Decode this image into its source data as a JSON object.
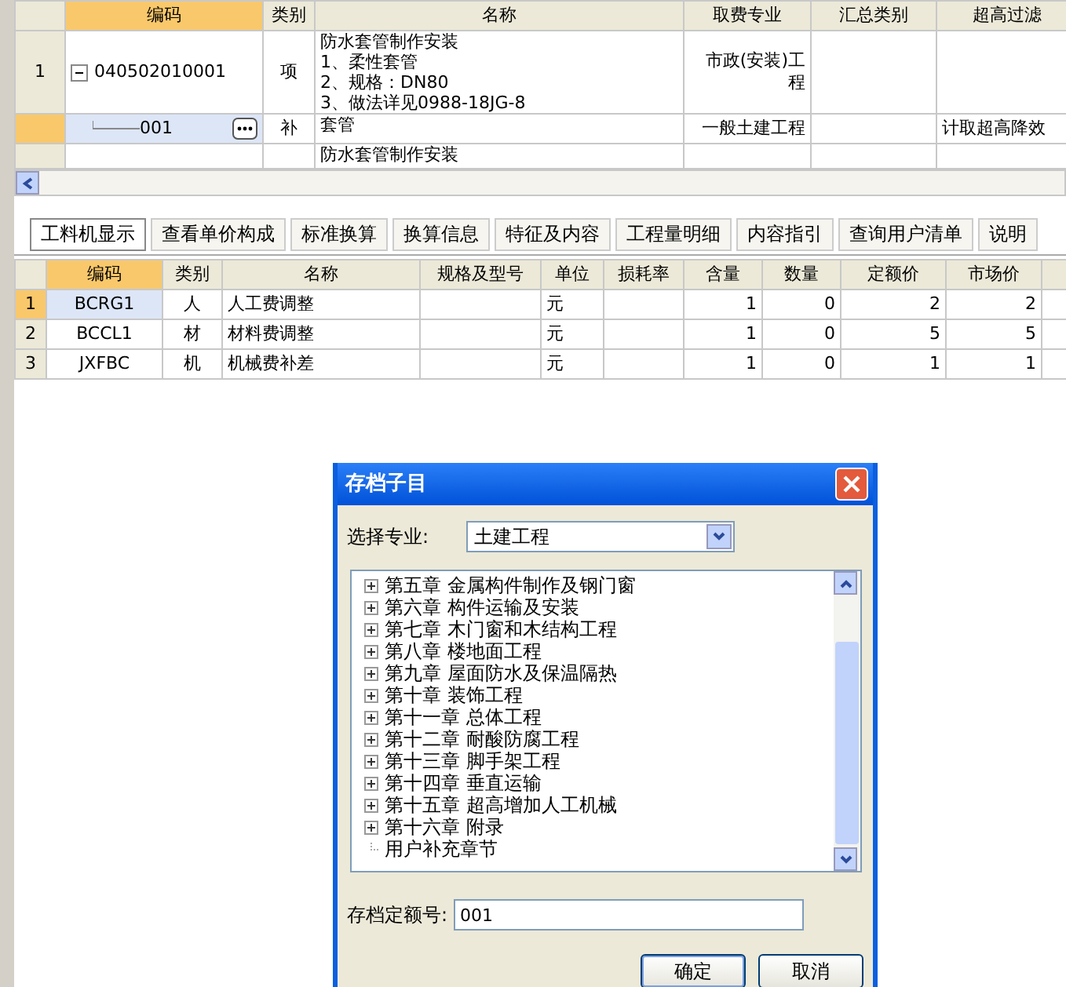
{
  "top_grid": {
    "columns": [
      "编码",
      "类别",
      "名称",
      "取费专业",
      "汇总类别",
      "超高过滤"
    ],
    "rows": [
      {
        "row_header": "1",
        "code": "040502010001",
        "expanded": true,
        "category": "项",
        "name_lines": [
          "防水套管制作安装",
          "1、柔性套管",
          "2、规格：DN80",
          "3、做法详见0988-18JG-8"
        ],
        "fee_specialty": "市政(安装)工程",
        "summary_category": "",
        "column_6": "",
        "selected": false,
        "child": false
      },
      {
        "row_header": "",
        "code": "001",
        "category": "补",
        "name_lines": [
          "套管"
        ],
        "fee_specialty": "一般土建工程",
        "summary_category": "",
        "column_6": "计取超高降效",
        "selected": true,
        "child": true
      },
      {
        "row_header": "",
        "code": "",
        "category": "",
        "name_lines": [
          "防水套管制作安装"
        ],
        "fee_specialty": "",
        "summary_category": "",
        "column_6": "",
        "selected": false,
        "child": false
      }
    ]
  },
  "tabs": [
    {
      "label": "工料机显示",
      "selected": true
    },
    {
      "label": "查看单价构成",
      "selected": false
    },
    {
      "label": "标准换算",
      "selected": false
    },
    {
      "label": "换算信息",
      "selected": false
    },
    {
      "label": "特征及内容",
      "selected": false
    },
    {
      "label": "工程量明细",
      "selected": false
    },
    {
      "label": "内容指引",
      "selected": false
    },
    {
      "label": "查询用户清单",
      "selected": false
    },
    {
      "label": "说明",
      "selected": false
    }
  ],
  "resource_grid": {
    "columns": [
      "编码",
      "类别",
      "名称",
      "规格及型号",
      "单位",
      "损耗率",
      "含量",
      "数量",
      "定额价",
      "市场价"
    ],
    "rows": [
      {
        "row_header": "1",
        "selected": true,
        "cells": [
          "BCRG1",
          "人",
          "人工费调整",
          "",
          "元",
          "",
          "1",
          "0",
          "2",
          "2"
        ]
      },
      {
        "row_header": "2",
        "selected": false,
        "cells": [
          "BCCL1",
          "材",
          "材料费调整",
          "",
          "元",
          "",
          "1",
          "0",
          "5",
          "5"
        ]
      },
      {
        "row_header": "3",
        "selected": false,
        "cells": [
          "JXFBC",
          "机",
          "机械费补差",
          "",
          "元",
          "",
          "1",
          "0",
          "1",
          "1"
        ]
      }
    ]
  },
  "dialog": {
    "title": "存档子目",
    "specialty_label": "选择专业:",
    "specialty_value": "土建工程",
    "tree_items": [
      {
        "label": "第五章  金属构件制作及钢门窗",
        "expandable": true
      },
      {
        "label": "第六章  构件运输及安装",
        "expandable": true
      },
      {
        "label": "第七章  木门窗和木结构工程",
        "expandable": true
      },
      {
        "label": "第八章  楼地面工程",
        "expandable": true
      },
      {
        "label": "第九章  屋面防水及保温隔热",
        "expandable": true
      },
      {
        "label": "第十章  装饰工程",
        "expandable": true
      },
      {
        "label": "第十一章  总体工程",
        "expandable": true
      },
      {
        "label": "第十二章  耐酸防腐工程",
        "expandable": true
      },
      {
        "label": "第十三章  脚手架工程",
        "expandable": true
      },
      {
        "label": "第十四章  垂直运输",
        "expandable": true
      },
      {
        "label": "第十五章  超高增加人工机械",
        "expandable": true
      },
      {
        "label": "第十六章  附录",
        "expandable": true
      },
      {
        "label": "用户补充章节",
        "expandable": false
      }
    ],
    "number_label": "存档定额号:",
    "number_value": "001",
    "buttons": [
      "确定",
      "取消"
    ]
  }
}
